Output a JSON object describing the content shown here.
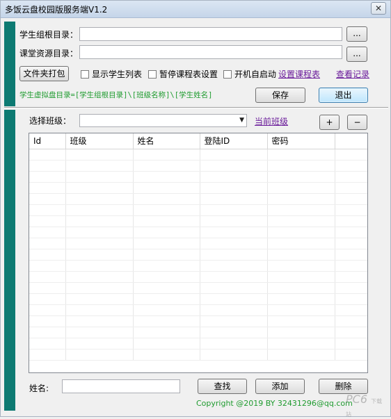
{
  "window": {
    "title": "多饭云盘校园版服务端V1.2",
    "close_glyph": "✕"
  },
  "top": {
    "student_root_label": "学生组根目录：",
    "student_root_value": "",
    "class_resource_label": "课堂资源目录：",
    "class_resource_value": "",
    "browse_label": "...",
    "pack_folder_button": "文件夹打包",
    "checkbox_show_students": "显示学生列表",
    "checkbox_pause_schedule": "暂停课程表设置",
    "checkbox_autostart": "开机自启动",
    "link_set_schedule": "设置课程表",
    "link_view_records": "查看记录",
    "path_note": "学生虚拟盘目录=[学生组根目录]\\[班级名称]\\[学生姓名]",
    "save_button": "保存",
    "exit_button": "退出"
  },
  "class": {
    "select_label": "选择班级：",
    "selected_value": "",
    "current_class_link": "当前班级",
    "add_button": "+",
    "remove_button": "−"
  },
  "table": {
    "columns": [
      "Id",
      "班级",
      "姓名",
      "登陆ID",
      "密码",
      ""
    ],
    "rows": []
  },
  "bottom": {
    "name_label": "姓名:",
    "name_value": "",
    "search_button": "查找",
    "add_button": "添加",
    "delete_button": "删除",
    "copyright": "Copyright @2019 BY 32431296@qq.com"
  },
  "watermark": {
    "text": "PC6",
    "sub": "下载站"
  },
  "colors": {
    "sidebar": "#0d7a72",
    "note_green": "#1f9b2f",
    "link_purple": "#6a1b9a"
  }
}
